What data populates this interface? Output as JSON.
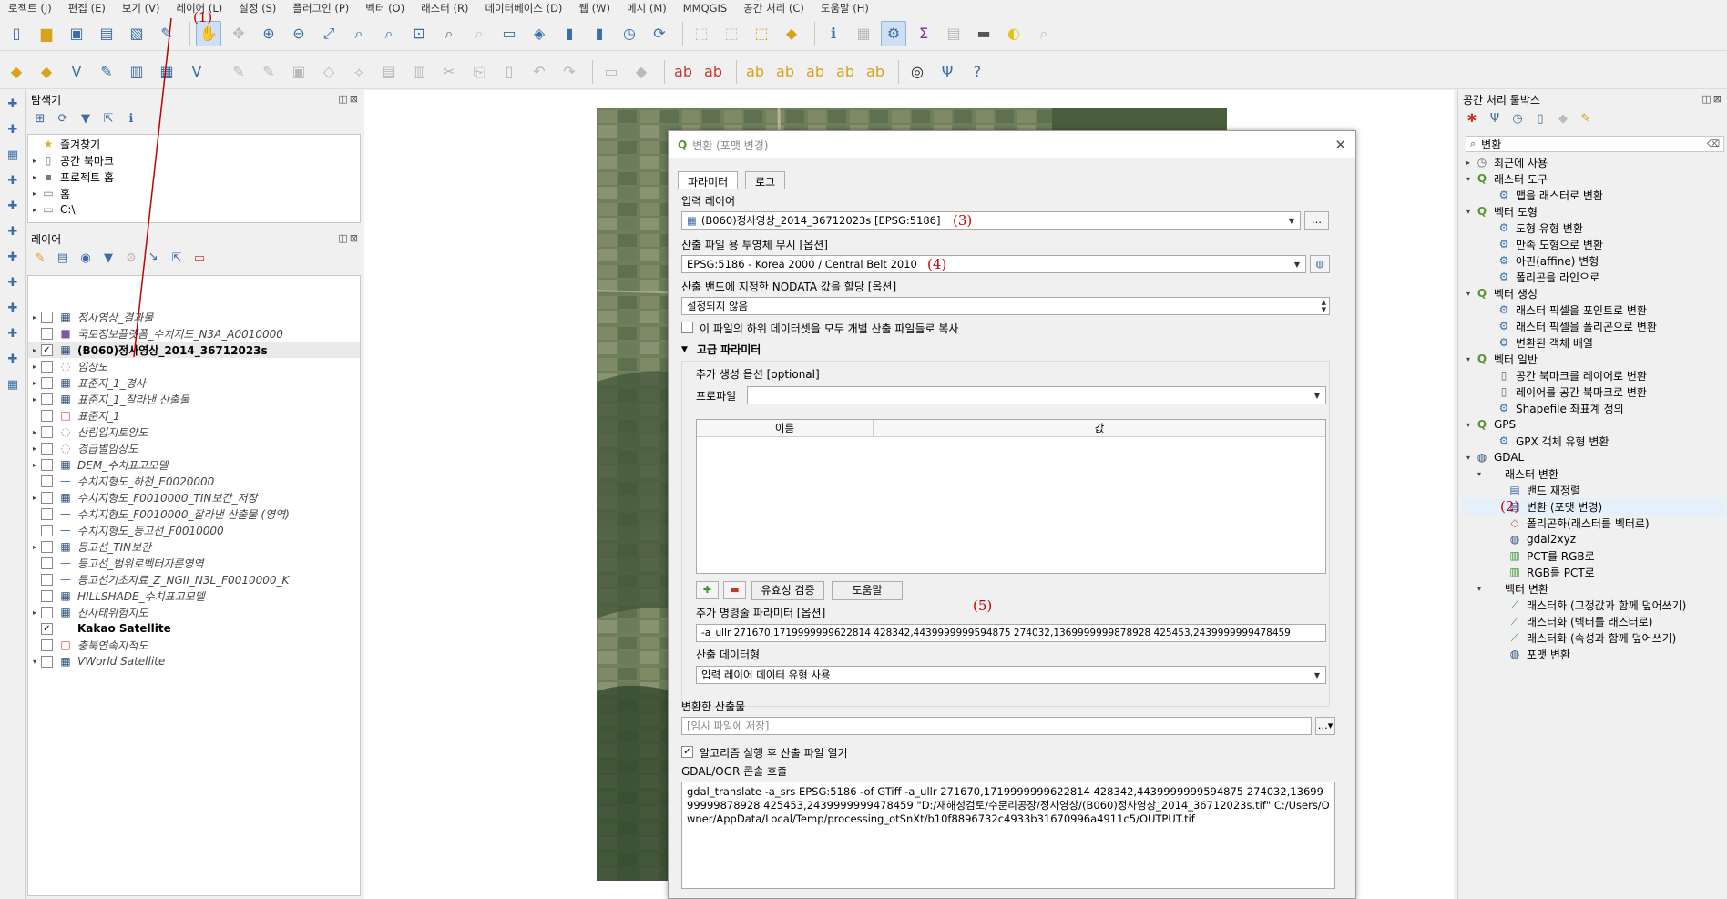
{
  "menu": [
    "로젝트 (J)",
    "편집 (E)",
    "보기 (V)",
    "레이어 (L)",
    "설정 (S)",
    "플러그인 (P)",
    "벡터 (O)",
    "래스터 (R)",
    "데이터베이스 (D)",
    "웹 (W)",
    "메시 (M)",
    "MMQGIS",
    "공간 처리 (C)",
    "도움말 (H)"
  ],
  "browser": {
    "title": "탐색기",
    "items": [
      {
        "label": "즐겨찾기",
        "arrow": "",
        "icon": "★"
      },
      {
        "label": "공간 북마크",
        "arrow": "▸",
        "icon": "▯"
      },
      {
        "label": "프로젝트 홈",
        "arrow": "▸",
        "icon": "▪"
      },
      {
        "label": "홈",
        "arrow": "▸",
        "icon": "▭"
      },
      {
        "label": "C:\\",
        "arrow": "▸",
        "icon": "▭"
      }
    ]
  },
  "layers": {
    "title": "레이어",
    "items": [
      {
        "label": "정사영상_결과물",
        "checked": "",
        "italic": true,
        "bold": false,
        "arrow": "▸",
        "icon": "▦"
      },
      {
        "label": "국토정보플랫폼_수치지도_N3A_A0010000",
        "checked": "",
        "italic": true,
        "bold": false,
        "arrow": "",
        "icon": "■"
      },
      {
        "label": "(B060)정사영상_2014_36712023s",
        "checked": "✓",
        "italic": false,
        "bold": true,
        "arrow": "▸",
        "icon": "▦"
      },
      {
        "label": "임상도",
        "checked": "",
        "italic": true,
        "bold": false,
        "arrow": "▸",
        "icon": "◌"
      },
      {
        "label": "표준지_1_경사",
        "checked": "",
        "italic": true,
        "bold": false,
        "arrow": "▸",
        "icon": "▦"
      },
      {
        "label": "표준지_1_잘라낸 산출물",
        "checked": "",
        "italic": true,
        "bold": false,
        "arrow": "▸",
        "icon": "▦"
      },
      {
        "label": "표준지_1",
        "checked": "",
        "italic": true,
        "bold": false,
        "arrow": "",
        "icon": "□"
      },
      {
        "label": "산림입지토양도",
        "checked": "",
        "italic": true,
        "bold": false,
        "arrow": "▸",
        "icon": "◌"
      },
      {
        "label": "경급별임상도",
        "checked": "",
        "italic": true,
        "bold": false,
        "arrow": "▸",
        "icon": "◌"
      },
      {
        "label": "DEM_수치표고모델",
        "checked": "",
        "italic": true,
        "bold": false,
        "arrow": "▸",
        "icon": "▦"
      },
      {
        "label": "수치지형도_하천_E0020000",
        "checked": "",
        "italic": true,
        "bold": false,
        "arrow": "",
        "icon": "—"
      },
      {
        "label": "수치지형도_F0010000_TIN보간_저장",
        "checked": "",
        "italic": true,
        "bold": false,
        "arrow": "▸",
        "icon": "▦"
      },
      {
        "label": "수치지형도_F0010000_잘라낸 산출물 (영역)",
        "checked": "",
        "italic": true,
        "bold": false,
        "arrow": "",
        "icon": "—"
      },
      {
        "label": "수치지형도_등고선_F0010000",
        "checked": "",
        "italic": true,
        "bold": false,
        "arrow": "",
        "icon": "—"
      },
      {
        "label": "등고선_TIN보간",
        "checked": "",
        "italic": true,
        "bold": false,
        "arrow": "▸",
        "icon": "▦"
      },
      {
        "label": "등고선_범위로벡터자른영역",
        "checked": "",
        "italic": true,
        "bold": false,
        "arrow": "",
        "icon": "—"
      },
      {
        "label": "등고선기초자료_Z_NGII_N3L_F0010000_K",
        "checked": "",
        "italic": true,
        "bold": false,
        "arrow": "",
        "icon": "—"
      },
      {
        "label": "HILLSHADE_수치표고모델",
        "checked": "",
        "italic": true,
        "bold": false,
        "arrow": "",
        "icon": "▦"
      },
      {
        "label": "산사태위험지도",
        "checked": "",
        "italic": true,
        "bold": false,
        "arrow": "▸",
        "icon": "▦"
      },
      {
        "label": "Kakao Satellite",
        "checked": "✓",
        "italic": false,
        "bold": true,
        "arrow": "",
        "icon": ""
      },
      {
        "label": "충북연속지적도",
        "checked": "",
        "italic": true,
        "bold": false,
        "arrow": "",
        "icon": "□"
      },
      {
        "label": "VWorld Satellite",
        "checked": "",
        "italic": true,
        "bold": false,
        "arrow": "▾",
        "icon": "▦"
      }
    ]
  },
  "dialog": {
    "title": "변환 (포맷 변경)",
    "tabs": [
      "파라미터",
      "로그"
    ],
    "input_layer_label": "입력 레이어",
    "input_layer_value": "(B060)정사영상_2014_36712023s [EPSG:5186]",
    "srs_label": "산출 파일 용 투영체 무시 [옵션]",
    "srs_value": "EPSG:5186 - Korea 2000 / Central Belt 2010",
    "nodata_label": "산출 밴드에 지정한 NODATA 값을 할당 [옵션]",
    "nodata_value": "설정되지 않음",
    "copy_subdatasets_label": "이 파일의 하위 데이터셋을 모두 개별 산출 파일들로 복사",
    "advanced_label": "고급 파라미터",
    "creation_options_label": "추가 생성 옵션 [optional]",
    "profile_label": "프로파일",
    "col_name": "이름",
    "col_value": "값",
    "validate_btn": "유효성 검증",
    "help_btn": "도움말",
    "extra_params_label": "추가 명령줄 파라미터 [옵션]",
    "extra_params_value": "-a_ullr 271670,1719999999622814 428342,4439999999594875 274032,1369999999878928 425453,2439999999478459",
    "dtype_label": "산출 데이터형",
    "dtype_value": "입력 레이어 데이터 유형 사용",
    "output_label": "변환한 산출물",
    "output_placeholder": "[임시 파일에 저장]",
    "open_after_label": "알고리즘 실행 후 산출 파일 열기",
    "console_label": "GDAL/OGR 콘솔 호출",
    "console_value": "gdal_translate -a_srs EPSG:5186 -of GTiff -a_ullr 271670,1719999999622814 428342,4439999999594875 274032,1369999999878928 425453,2439999999478459 \"D:/재해성검토/수문리공장/정사영상/(B060)정사영상_2014_36712023s.tif\" C:/Users/Owner/AppData/Local/Temp/processing_otSnXt/b10f8896732c4933b31670996a4911c5/OUTPUT.tif"
  },
  "toolbox": {
    "title": "공간 처리 툴박스",
    "search_value": "변환",
    "items": [
      {
        "label": "최근에 사용",
        "indent": 0,
        "arrow": "▸",
        "icon": "◷",
        "hl": false
      },
      {
        "label": "래스터 도구",
        "indent": 0,
        "arrow": "▾",
        "icon": "Q",
        "hl": false
      },
      {
        "label": "맵을 래스터로 변환",
        "indent": 2,
        "arrow": "",
        "icon": "⚙",
        "hl": false
      },
      {
        "label": "벡터 도형",
        "indent": 0,
        "arrow": "▾",
        "icon": "Q",
        "hl": false
      },
      {
        "label": "도형 유형 변환",
        "indent": 2,
        "arrow": "",
        "icon": "⚙",
        "hl": false
      },
      {
        "label": "만족 도형으로 변환",
        "indent": 2,
        "arrow": "",
        "icon": "⚙",
        "hl": false
      },
      {
        "label": "아핀(affine) 변형",
        "indent": 2,
        "arrow": "",
        "icon": "⚙",
        "hl": false
      },
      {
        "label": "폴리곤을 라인으로",
        "indent": 2,
        "arrow": "",
        "icon": "⚙",
        "hl": false
      },
      {
        "label": "벡터 생성",
        "indent": 0,
        "arrow": "▾",
        "icon": "Q",
        "hl": false
      },
      {
        "label": "래스터 픽셀을 포인트로 변환",
        "indent": 2,
        "arrow": "",
        "icon": "⚙",
        "hl": false
      },
      {
        "label": "래스터 픽셀을 폴리곤으로 변환",
        "indent": 2,
        "arrow": "",
        "icon": "⚙",
        "hl": false
      },
      {
        "label": "변환된 객체 배열",
        "indent": 2,
        "arrow": "",
        "icon": "⚙",
        "hl": false
      },
      {
        "label": "벡터 일반",
        "indent": 0,
        "arrow": "▾",
        "icon": "Q",
        "hl": false
      },
      {
        "label": "공간 북마크를 레이어로 변환",
        "indent": 2,
        "arrow": "",
        "icon": "▯",
        "hl": false
      },
      {
        "label": "레이어를 공간 북마크로 변환",
        "indent": 2,
        "arrow": "",
        "icon": "▯",
        "hl": false
      },
      {
        "label": "Shapefile 좌표계 정의",
        "indent": 2,
        "arrow": "",
        "icon": "⚙",
        "hl": false
      },
      {
        "label": "GPS",
        "indent": 0,
        "arrow": "▾",
        "icon": "Q",
        "hl": false
      },
      {
        "label": "GPX 객체 유형 변환",
        "indent": 2,
        "arrow": "",
        "icon": "⚙",
        "hl": false
      },
      {
        "label": "GDAL",
        "indent": 0,
        "arrow": "▾",
        "icon": "◍",
        "hl": false
      },
      {
        "label": "래스터 변환",
        "indent": 1,
        "arrow": "▾",
        "icon": "",
        "hl": false
      },
      {
        "label": "밴드 재정렬",
        "indent": 3,
        "arrow": "",
        "icon": "▤",
        "hl": false
      },
      {
        "label": "변환 (포맷 변경)",
        "indent": 3,
        "arrow": "",
        "icon": "▤",
        "hl": true
      },
      {
        "label": "폴리곤화(래스터를 벡터로)",
        "indent": 3,
        "arrow": "",
        "icon": "◇",
        "hl": false
      },
      {
        "label": "gdal2xyz",
        "indent": 3,
        "arrow": "",
        "icon": "◍",
        "hl": false
      },
      {
        "label": "PCT를 RGB로",
        "indent": 3,
        "arrow": "",
        "icon": "▥",
        "hl": false
      },
      {
        "label": "RGB를 PCT로",
        "indent": 3,
        "arrow": "",
        "icon": "▥",
        "hl": false
      },
      {
        "label": "벡터 변환",
        "indent": 1,
        "arrow": "▾",
        "icon": "",
        "hl": false
      },
      {
        "label": "래스터화 (고정값과 함께 덮어쓰기)",
        "indent": 3,
        "arrow": "",
        "icon": "⟋",
        "hl": false
      },
      {
        "label": "래스터화 (벡터를 래스터로)",
        "indent": 3,
        "arrow": "",
        "icon": "⟋",
        "hl": false
      },
      {
        "label": "래스터화 (속성과 함께 덮어쓰기)",
        "indent": 3,
        "arrow": "",
        "icon": "⟋",
        "hl": false
      },
      {
        "label": "포맷 변환",
        "indent": 3,
        "arrow": "",
        "icon": "◍",
        "hl": false
      }
    ]
  },
  "annotations": {
    "a1": "(1)",
    "a2": "(2)",
    "a3": "(3)",
    "a4": "(4)",
    "a5": "(5)"
  },
  "colors": {
    "annotation": "#c00000",
    "accent": "#3b6ea5",
    "highlight": "#e5f0fb"
  }
}
